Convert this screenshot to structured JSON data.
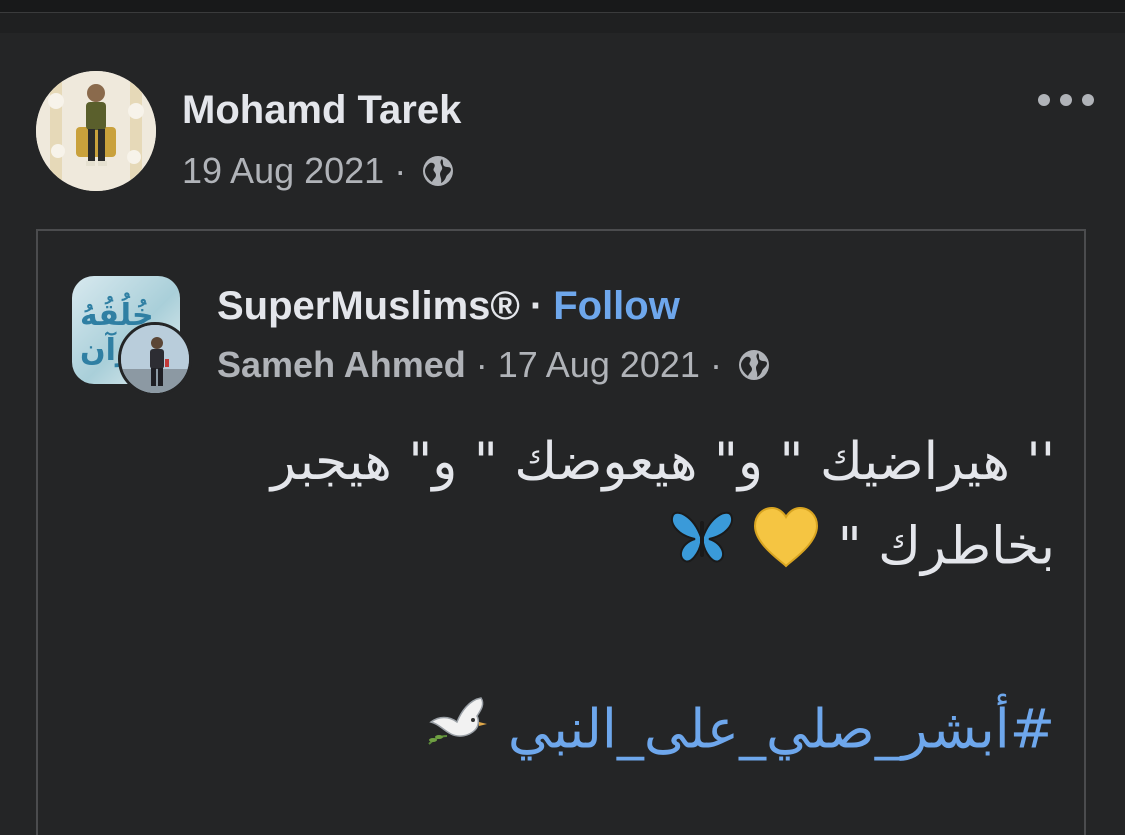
{
  "post": {
    "author_name": "Mohamd Tarek",
    "date": "19 Aug 2021",
    "separator": "·",
    "audience_icon": "globe-icon",
    "more_icon": "more-options-icon"
  },
  "shared_post": {
    "page_name": "SuperMuslims®",
    "follow_label": "Follow",
    "separator": "·",
    "poster_name": "Sameh Ahmed",
    "date": "17 Aug 2021",
    "audience_icon": "globe-icon",
    "page_avatar_text": "خُلُقُهُ القرآن",
    "text_line1": "'' هيراضيك \" و\" هيعوضك \" و\" هيجبر",
    "text_line2": "بخاطرك \"",
    "hashtag": "#أبشر_صلي_على_النبي",
    "emoji_1": "yellow-heart-icon",
    "emoji_2": "butterfly-icon",
    "emoji_3": "dove-icon"
  },
  "colors": {
    "background": "#242526",
    "text_primary": "#e4e6eb",
    "text_secondary": "#b0b3b8",
    "link": "#6ea7ec",
    "border": "#4b4c4e"
  }
}
